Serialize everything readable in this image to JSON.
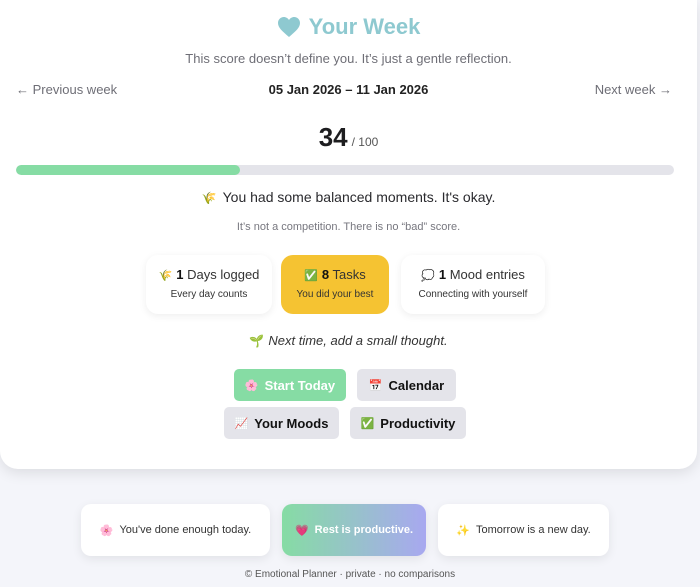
{
  "header": {
    "title": "Your Week",
    "subtitle": "This score doesn’t define you. It’s just a gentle reflection."
  },
  "nav": {
    "previous": "← Previous week",
    "next": "Next week →",
    "date_range": "05 Jan 2026 – 11 Jan 2026"
  },
  "score": {
    "value": "34",
    "max_label": "/ 100",
    "progress_fraction": 0.34
  },
  "message": {
    "emoji": "🌾",
    "text": "You had some balanced moments. It's okay.",
    "note": "It’s not a competition. There is no “bad” score."
  },
  "stats": {
    "days": {
      "emoji": "🌾",
      "count": "1",
      "label": "Days logged",
      "sub": "Every day counts"
    },
    "tasks": {
      "emoji": "✅",
      "count": "8",
      "label": "Tasks",
      "sub": "You did your best"
    },
    "mood": {
      "emoji": "💭",
      "count": "1",
      "label": "Mood entries",
      "sub": "Connecting with yourself"
    }
  },
  "hint": {
    "emoji": "🌱",
    "text": "Next time, add a small thought."
  },
  "buttons": {
    "start": {
      "emoji": "🌸",
      "label": "Start Today"
    },
    "calendar": {
      "emoji": "📅",
      "label": "Calendar"
    },
    "moods": {
      "emoji": "📈",
      "label": "Your Moods"
    },
    "productivity": {
      "emoji": "✅",
      "label": "Productivity"
    }
  },
  "footer": {
    "cards": [
      {
        "emoji": "🌸",
        "text": "You've done enough today."
      },
      {
        "emoji": "💗",
        "text": "Rest is productive."
      },
      {
        "emoji": "✨",
        "text": "Tomorrow is a new day."
      }
    ],
    "copyright": "© Emotional Planner · private · no comparisons"
  },
  "colors": {
    "accent_title": "#8ec9d0",
    "progress_green": "#86dca4",
    "tasks_yellow": "#f5c332"
  }
}
